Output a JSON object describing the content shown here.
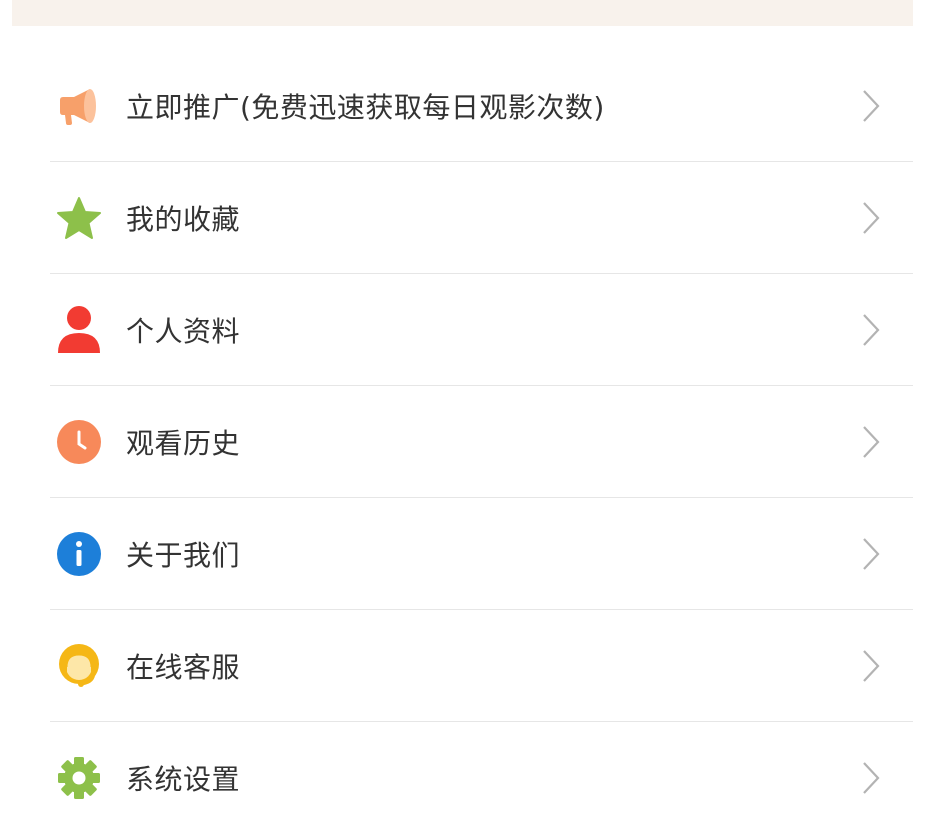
{
  "menu": {
    "items": [
      {
        "label": "立即推广(免费迅速获取每日观影次数)",
        "icon": "megaphone-icon",
        "color": "#f7a06a"
      },
      {
        "label": "我的收藏",
        "icon": "star-icon",
        "color": "#8dc04a"
      },
      {
        "label": "个人资料",
        "icon": "user-icon",
        "color": "#f23b32"
      },
      {
        "label": "观看历史",
        "icon": "clock-icon",
        "color": "#f7895a"
      },
      {
        "label": "关于我们",
        "icon": "info-icon",
        "color": "#1d7fd9"
      },
      {
        "label": "在线客服",
        "icon": "headset-icon",
        "color": "#f5b716"
      },
      {
        "label": "系统设置",
        "icon": "gear-icon",
        "color": "#8dc04a"
      }
    ]
  },
  "colors": {
    "banner": "#f8f2ec",
    "divider": "#e6e6e6",
    "text": "#333333",
    "chevron": "#b3b3b3"
  }
}
